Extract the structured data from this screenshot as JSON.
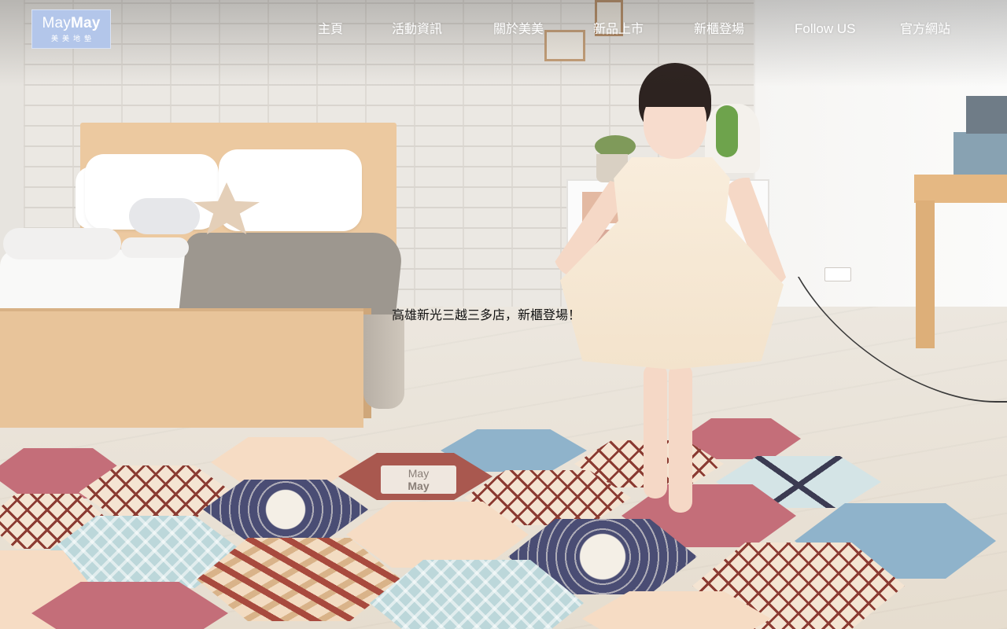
{
  "brand": {
    "logo_text_light": "May",
    "logo_text_bold": "May",
    "logo_subtitle": "美美地墊",
    "logo_bg_color": "#b3c6ea"
  },
  "nav": {
    "items": [
      {
        "label": "主頁"
      },
      {
        "label": "活動資訊"
      },
      {
        "label": "關於美美"
      },
      {
        "label": "新品上市"
      },
      {
        "label": "新櫃登場"
      },
      {
        "label": "Follow US"
      },
      {
        "label": "官方網站"
      }
    ],
    "text_color": "#ffffff"
  },
  "hero": {
    "caption": "高雄新光三越三多店，新櫃登場！",
    "mat_logo_light": "May",
    "mat_logo_bold": "May",
    "caption_color": "#111111"
  }
}
